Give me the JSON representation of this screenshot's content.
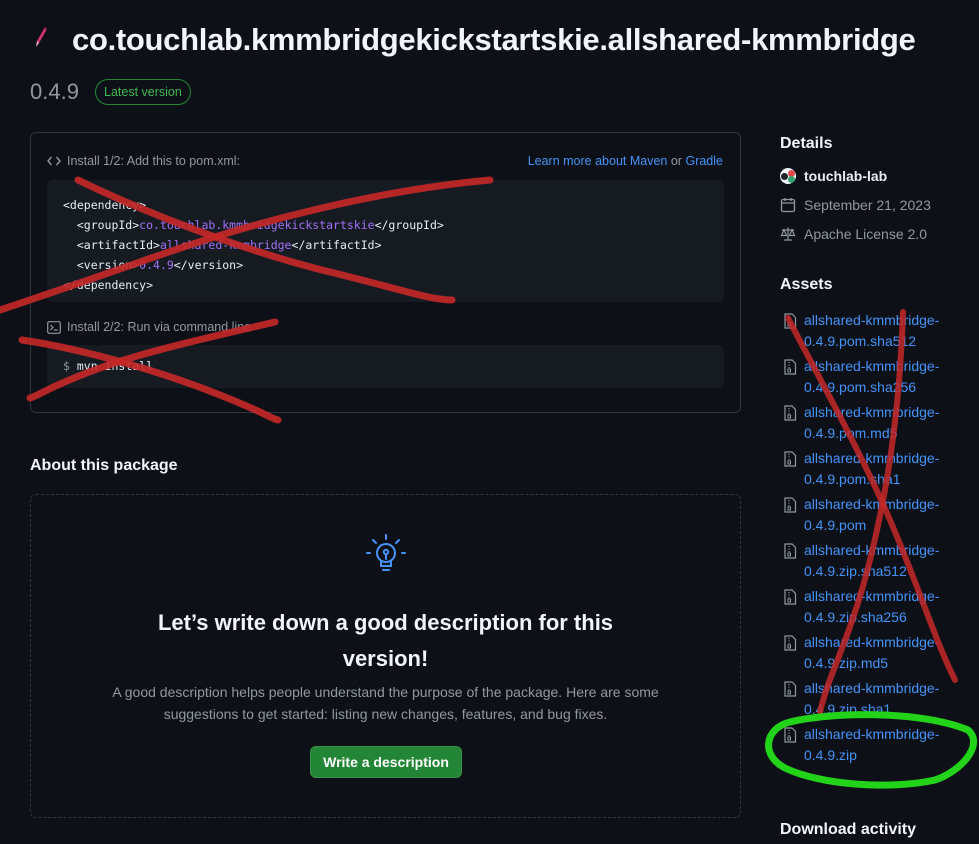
{
  "header": {
    "title": "co.touchlab.kmmbridgekickstartskie.allshared-kmmbridge",
    "version": "0.4.9",
    "badge": "Latest version"
  },
  "install": {
    "step1_label": "Install 1/2: Add this to pom.xml:",
    "learn_prefix": "Learn more about Maven",
    "learn_or": "or",
    "learn_gradle": "Gradle",
    "code_lines": [
      {
        "pre": "<dependency>",
        "val": "",
        "post": ""
      },
      {
        "pre": "  <groupId>",
        "val": "co.touchlab.kmmbridgekickstartskie",
        "post": "</groupId>"
      },
      {
        "pre": "  <artifactId>",
        "val": "allshared-kmmbridge",
        "post": "</artifactId>"
      },
      {
        "pre": "  <version>",
        "val": "0.4.9",
        "post": "</version>"
      },
      {
        "pre": "</dependency>",
        "val": "",
        "post": ""
      }
    ],
    "step2_label": "Install 2/2: Run via command line",
    "cmd_prompt": "$",
    "cmd": "mvn install"
  },
  "about": {
    "heading": "About this package",
    "title_line1": "Let’s write down a good description for this",
    "title_line2": "version!",
    "text": "A good description helps people understand the purpose of the package. Here are some suggestions to get started: listing new changes, features, and bug fixes.",
    "button": "Write a description"
  },
  "details": {
    "heading": "Details",
    "owner": "touchlab-lab",
    "date": "September 21, 2023",
    "license": "Apache License 2.0"
  },
  "assets": {
    "heading": "Assets",
    "items": [
      {
        "line1": "allshared-kmmbridge-",
        "line2": "0.4.9.pom.sha512"
      },
      {
        "line1": "allshared-kmmbridge-",
        "line2": "0.4.9.pom.sha256"
      },
      {
        "line1": "allshared-kmmbridge-",
        "line2": "0.4.9.pom.md5"
      },
      {
        "line1": "allshared-kmmbridge-",
        "line2": "0.4.9.pom.sha1"
      },
      {
        "line1": "allshared-kmmbridge-",
        "line2": "0.4.9.pom"
      },
      {
        "line1": "allshared-kmmbridge-",
        "line2": "0.4.9.zip.sha512"
      },
      {
        "line1": "allshared-kmmbridge-",
        "line2": "0.4.9.zip.sha256"
      },
      {
        "line1": "allshared-kmmbridge-",
        "line2": "0.4.9.zip.md5"
      },
      {
        "line1": "allshared-kmmbridge-",
        "line2": "0.4.9.zip.sha1"
      },
      {
        "line1": "allshared-kmmbridge-",
        "line2": "0.4.9.zip"
      }
    ]
  },
  "download": {
    "heading": "Download activity"
  },
  "colors": {
    "background": "#0d1117",
    "link": "#4493f8",
    "accent_green": "#238636",
    "scribble_red": "#c62828",
    "scribble_green": "#22d319"
  }
}
